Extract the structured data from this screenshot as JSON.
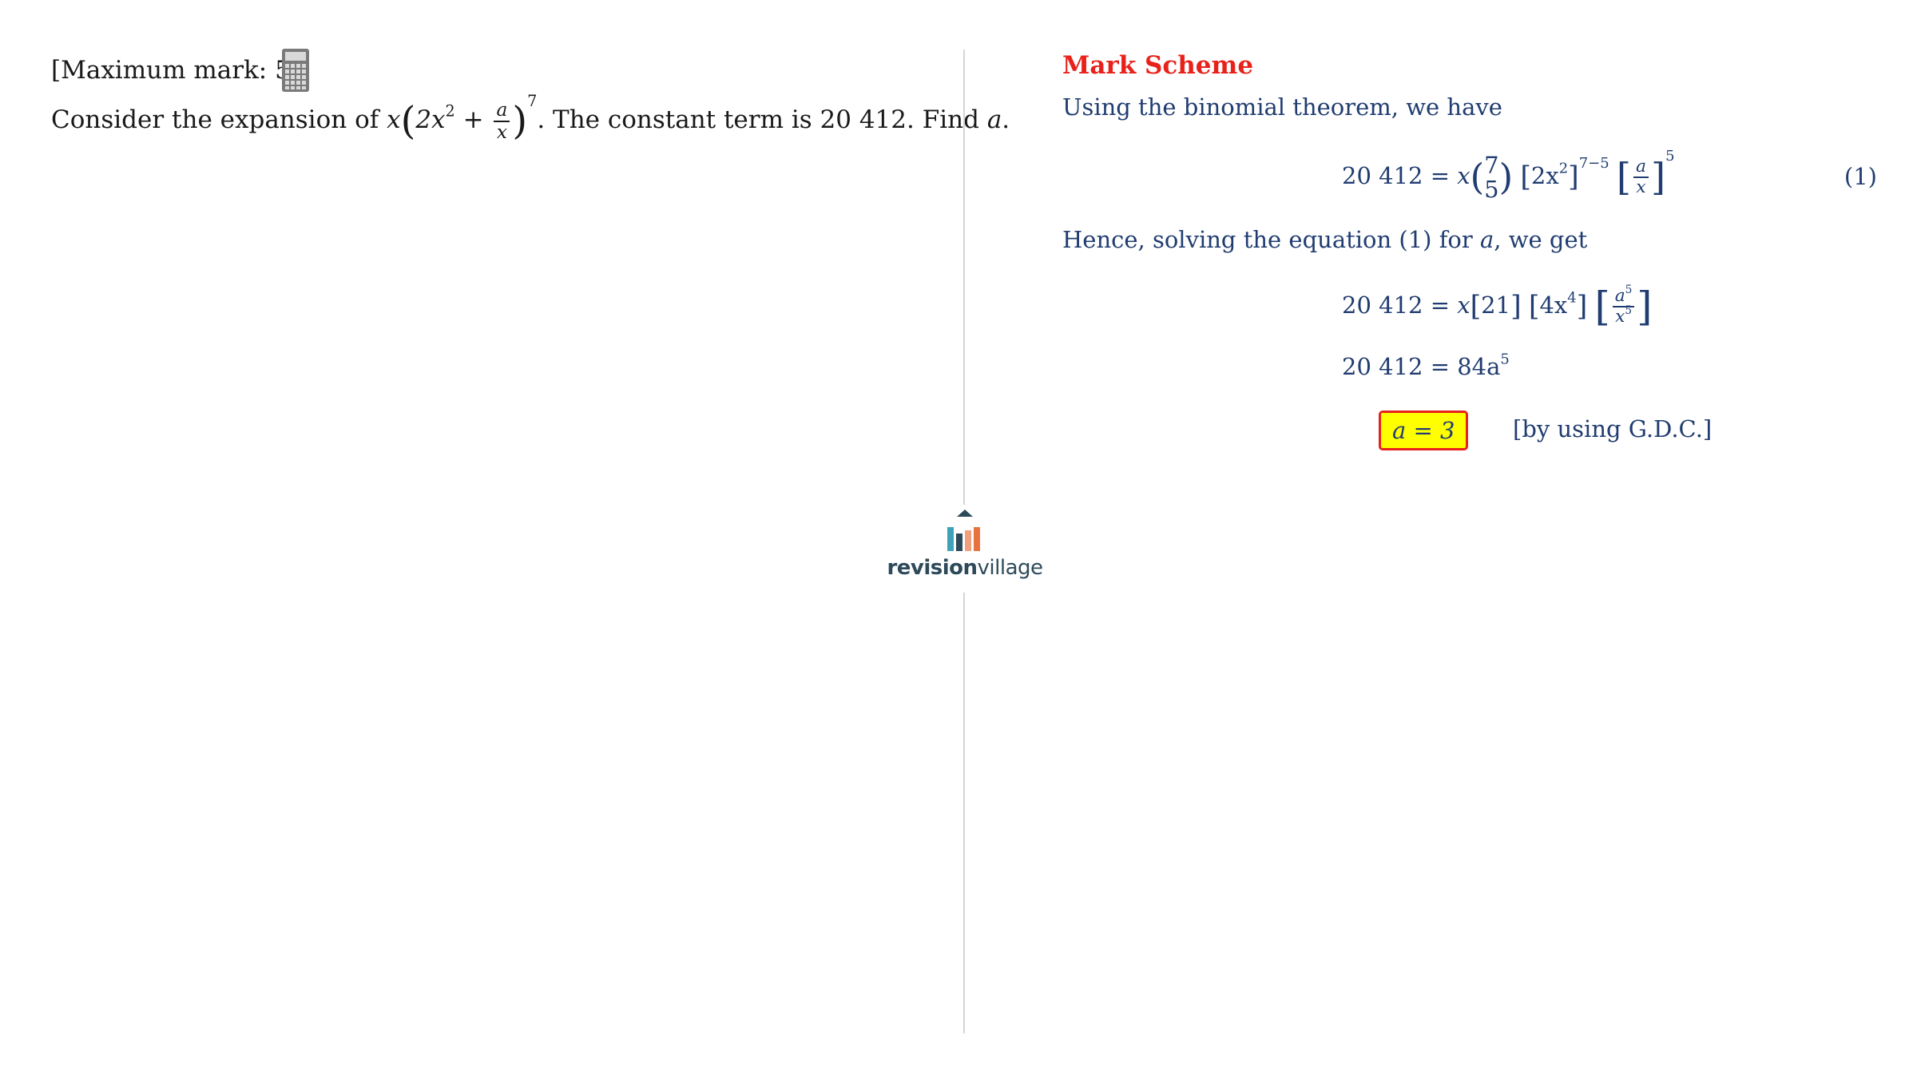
{
  "question": {
    "max_mark": "[Maximum mark: 5]",
    "calculator_icon": "calculator-icon",
    "text_before": "Consider the expansion of",
    "var_x": "x",
    "inner": "2x",
    "inner_exp": "2",
    "plus": "+",
    "frac_num": "a",
    "frac_den": "x",
    "outer_exp": "7",
    "text_after": ". The constant term is 20 412. Find",
    "var_a": "a",
    "period": "."
  },
  "logo": {
    "bold": "revision",
    "light": "village",
    "colors": [
      "#2d4a5a",
      "#3ea3b8",
      "#f2a07c",
      "#e8733f"
    ]
  },
  "mark_scheme": {
    "title": "Mark Scheme",
    "intro": "Using the binomial theorem, we have",
    "eq1": {
      "lhs": "20 412 =",
      "x": "x",
      "binom_top": "7",
      "binom_bottom": "5",
      "inner": "2x",
      "inner_exp": "2",
      "power": "7−5",
      "frac_num": "a",
      "frac_den": "x",
      "frac_power": "5",
      "number": "(1)"
    },
    "solving_text_1": "Hence, solving the equation (1) for",
    "solving_var": "a",
    "solving_text_2": ", we get",
    "eq2": {
      "lhs": "20 412 =",
      "x": "x",
      "b1": "21",
      "b2_coef": "4x",
      "b2_exp": "4",
      "frac_num": "a",
      "frac_num_exp": "5",
      "frac_den": "x",
      "frac_den_exp": "5"
    },
    "eq3": {
      "lhs": "20 412 =",
      "rhs": "84a",
      "rhs_exp": "5"
    },
    "answer": "a = 3",
    "answer_note": "[by using G.D.C.]",
    "colors": {
      "title": "#e8221b",
      "body": "#203c70",
      "highlight": "#ffff00",
      "box_border": "#e8221b"
    }
  }
}
